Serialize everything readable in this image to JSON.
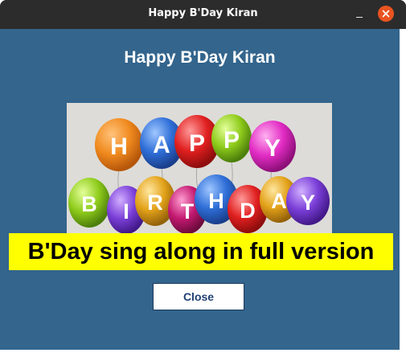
{
  "window": {
    "title": "Happy B'Day Kiran",
    "minimize_glyph": "–"
  },
  "dialog": {
    "heading": "Happy B'Day Kiran",
    "picture": {
      "icon": "balloons-image",
      "letters_row1": [
        "H",
        "A",
        "P",
        "P",
        "Y"
      ],
      "letters_row2": [
        "B",
        "I",
        "R",
        "T",
        "H",
        "D",
        "A",
        "Y"
      ]
    },
    "banner_text": "B'Day sing along in full version",
    "close_label": "Close"
  },
  "colors": {
    "client_bg": "#33658d",
    "titlebar_bg": "#2c2c2c",
    "close_circle": "#e95420",
    "banner_bg": "#ffff00",
    "button_text": "#1f3f73"
  }
}
